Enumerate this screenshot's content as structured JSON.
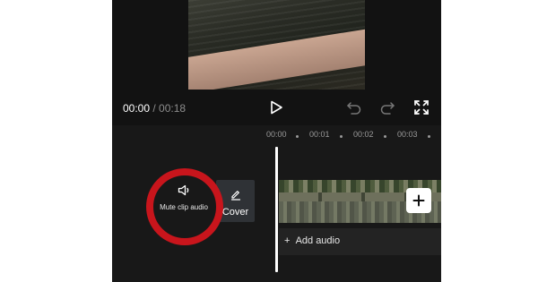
{
  "player": {
    "current_time": "00:00",
    "separator": " / ",
    "total_time": "00:18"
  },
  "controls": {
    "play_icon": "play-icon",
    "undo_icon": "undo-icon",
    "redo_icon": "redo-icon",
    "fullscreen_icon": "fullscreen-icon"
  },
  "ruler": {
    "ticks": [
      "00:00",
      "00:01",
      "00:02",
      "00:03"
    ]
  },
  "track": {
    "mute_label": "Mute clip audio",
    "cover_label": "Cover",
    "add_audio_label": "Add audio",
    "add_audio_icon": "+"
  },
  "colors": {
    "editor_bg": "#121212",
    "timeline_bg": "#181818",
    "highlight_ring": "#c8151c",
    "playhead": "#ffffff"
  }
}
